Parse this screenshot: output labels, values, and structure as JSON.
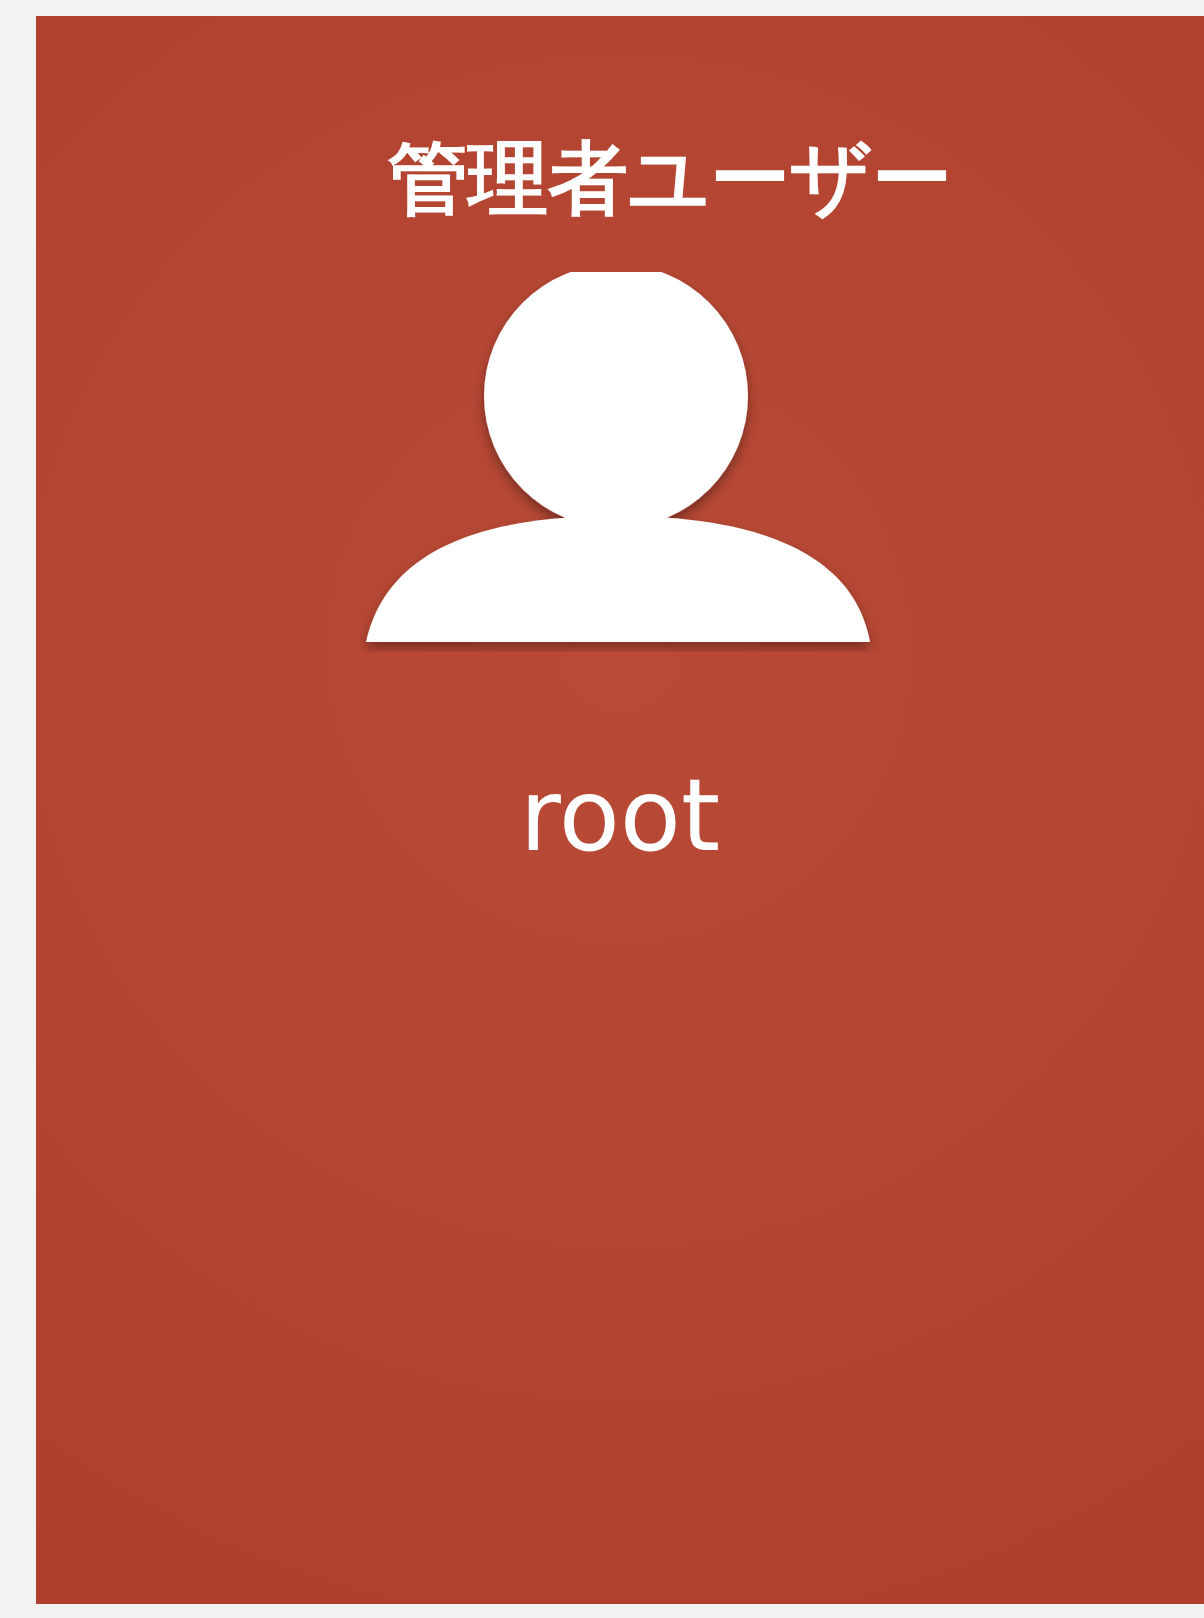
{
  "title": "管理者ユーザー",
  "user": {
    "name": "root"
  }
}
